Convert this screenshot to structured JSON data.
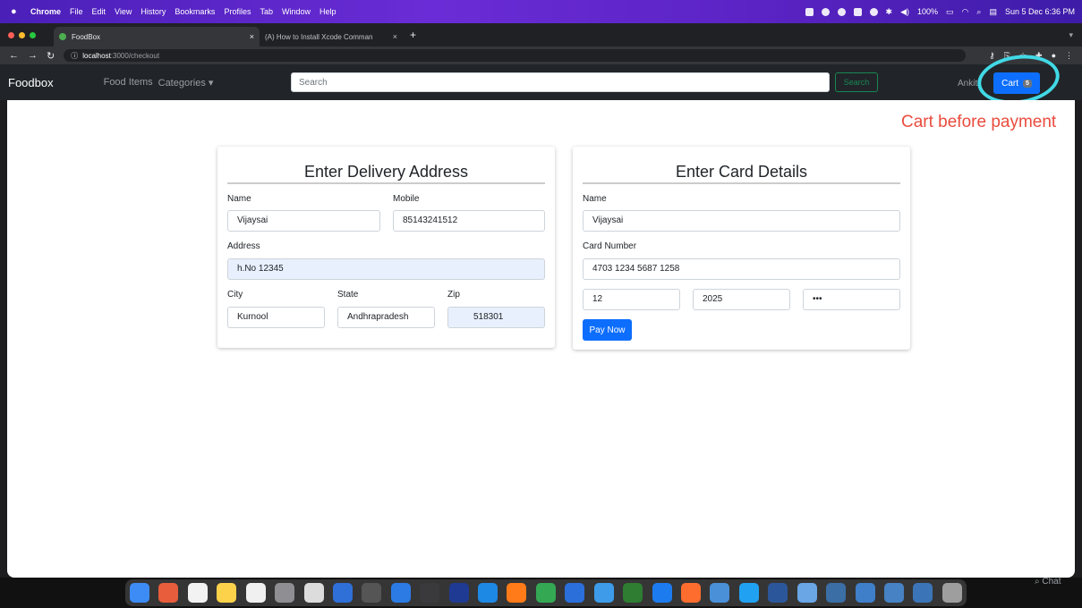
{
  "menubar": {
    "app": "Chrome",
    "items": [
      "File",
      "Edit",
      "View",
      "History",
      "Bookmarks",
      "Profiles",
      "Tab",
      "Window",
      "Help"
    ],
    "battery": "100%",
    "clock": "Sun 5 Dec  6:36 PM"
  },
  "tabs": [
    {
      "title": "FoodBox",
      "close": "×"
    },
    {
      "title": "(A) How to Install Xcode Comman",
      "close": "×"
    }
  ],
  "new_tab": "+",
  "address": {
    "host": "localhost",
    "path": ":3000/checkout"
  },
  "navbar": {
    "brand": "Foodbox",
    "links": [
      "Food Items",
      "Categories ▾"
    ],
    "search_placeholder": "Search",
    "search_button": "Search",
    "user": "Ankit",
    "cart_label": "Cart",
    "cart_count": "5"
  },
  "annotation": "Cart before payment",
  "delivery": {
    "title": "Enter Delivery Address",
    "name_label": "Name",
    "name_value": "Vijaysai",
    "mobile_label": "Mobile",
    "mobile_value": "85143241512",
    "address_label": "Address",
    "address_value": "h.No 12345",
    "city_label": "City",
    "city_value": "Kurnool",
    "state_label": "State",
    "state_value": "Andhrapradesh",
    "zip_label": "Zip",
    "zip_value": "518301"
  },
  "card": {
    "title": "Enter Card Details",
    "name_label": "Name",
    "name_value": "Vijaysai",
    "number_label": "Card Number",
    "number_value": "4703 1234 5687 1258",
    "month_value": "12",
    "year_value": "2025",
    "cvv_value": "•••",
    "pay_button": "Pay Now"
  },
  "chat_label": "Chat",
  "colors": {
    "primary": "#0d6efd",
    "success": "#198754",
    "annotation": "#ea4c3d",
    "ring": "#41d9e6",
    "navbar": "#212529"
  }
}
